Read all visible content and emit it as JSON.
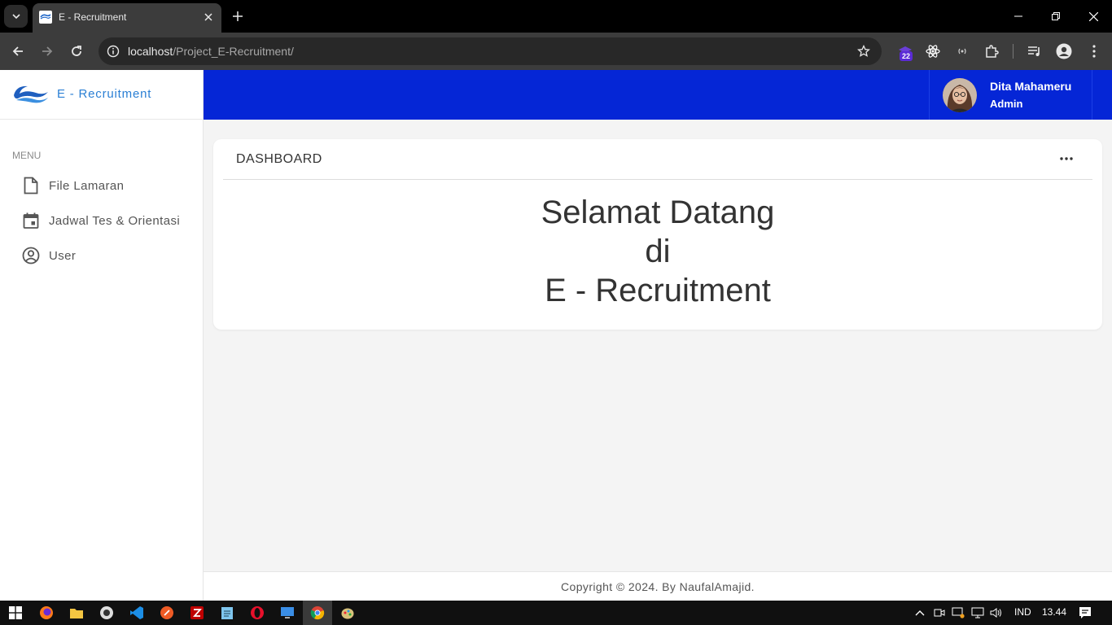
{
  "browser": {
    "tab_title": "E - Recruitment",
    "url_host": "localhost",
    "url_path": "/Project_E-Recruitment/",
    "extension_badge": "22"
  },
  "sidebar": {
    "brand": "E - Recruitment",
    "menu_caption": "MENU",
    "items": [
      {
        "label": "File Lamaran",
        "icon": "file-icon"
      },
      {
        "label": "Jadwal Tes & Orientasi",
        "icon": "calendar-icon"
      },
      {
        "label": "User",
        "icon": "user-circle-icon"
      }
    ]
  },
  "header": {
    "user_name": "Dita Mahameru",
    "user_role": "Admin"
  },
  "dashboard": {
    "title": "DASHBOARD",
    "welcome_line1": "Selamat Datang",
    "welcome_line2": "di",
    "welcome_line3": "E - Recruitment"
  },
  "footer": {
    "copyright": "Copyright © 2024. By NaufalAmajid."
  },
  "taskbar": {
    "language": "IND",
    "time": "13.44"
  },
  "colors": {
    "topbar": "#0526d6",
    "brand": "#2a7fd4"
  }
}
